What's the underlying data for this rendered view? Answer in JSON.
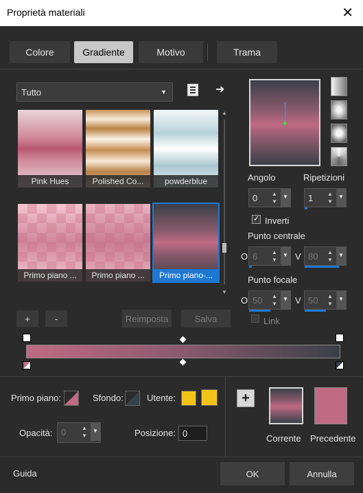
{
  "window": {
    "title": "Proprietà materiali"
  },
  "tabs": [
    {
      "label": "Colore"
    },
    {
      "label": "Gradiente"
    },
    {
      "label": "Motivo"
    },
    {
      "label": "Trama"
    }
  ],
  "category": {
    "value": "Tutto"
  },
  "gradients": [
    {
      "label": "Pink Hues"
    },
    {
      "label": "Polished Co..."
    },
    {
      "label": "powderblue"
    },
    {
      "label": "Primo piano ..."
    },
    {
      "label": "Primo piano ..."
    },
    {
      "label": "Primo piano-..."
    }
  ],
  "actions": {
    "add": "+",
    "remove": "-",
    "reset": "Reimposta",
    "save": "Salva"
  },
  "params": {
    "angle_label": "Angolo",
    "angle": "0",
    "repeat_label": "Ripetizioni",
    "repeat": "1",
    "invert_label": "Inverti",
    "center_label": "Punto centrale",
    "center_o_label": "O",
    "center_o": "6",
    "center_v_label": "V",
    "center_v": "80",
    "focal_label": "Punto focale",
    "focal_o_label": "O",
    "focal_o": "50",
    "focal_v_label": "V",
    "focal_v": "50",
    "link_label": "Link"
  },
  "bottom": {
    "foreground_label": "Primo piano:",
    "background_label": "Sfondo:",
    "user_label": "Utente:",
    "opacity_label": "Opacità:",
    "opacity": "0",
    "position_label": "Posizione:",
    "position": "0",
    "current_label": "Corrente",
    "previous_label": "Precedente"
  },
  "footer": {
    "help": "Guida",
    "ok": "OK",
    "cancel": "Annulla"
  },
  "colors": {
    "accent": "#1e78d2",
    "pink": "#c06a85",
    "dark": "#3a4048",
    "user": "#f2c41a"
  }
}
